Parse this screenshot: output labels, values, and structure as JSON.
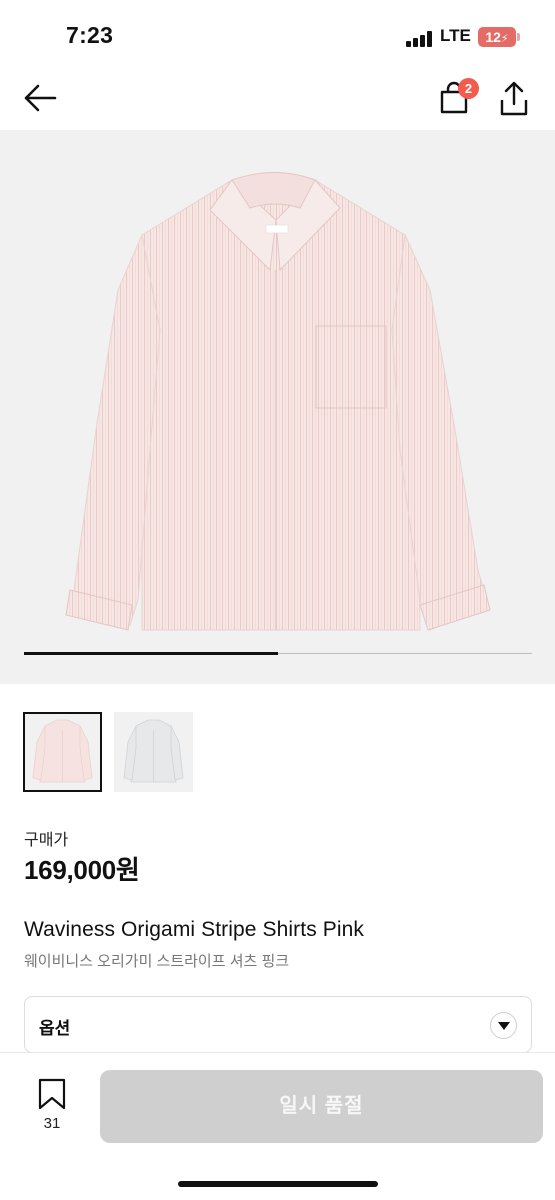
{
  "status_bar": {
    "time": "7:23",
    "network": "LTE",
    "battery": "12"
  },
  "nav": {
    "cart_count": "2"
  },
  "gallery": {
    "progress": 0.5,
    "thumbnails": [
      "pink-shirt",
      "gray-shirt"
    ],
    "selected_index": 0
  },
  "price": {
    "label": "구매가",
    "value": "169,000원"
  },
  "product": {
    "title_en": "Waviness Origami Stripe Shirts Pink",
    "title_ko": "웨이비니스 오리가미 스트라이프 셔츠 핑크"
  },
  "option": {
    "label": "옵션"
  },
  "bottom_bar": {
    "bookmark_count": "31",
    "cta_label": "일시 품절"
  },
  "colors": {
    "accent_badge": "#f25b4d",
    "battery": "#e56b66",
    "cta_disabled": "#cfcfcf",
    "shirt_pink": "#f4e3e1"
  }
}
